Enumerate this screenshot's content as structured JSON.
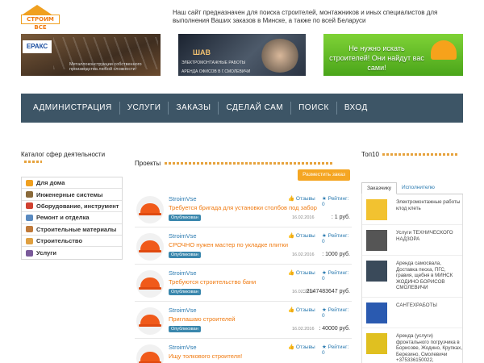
{
  "header": {
    "logo_text": "СТРОИМ ВСЕ",
    "intro": "Наш сайт предназначен для поиска строителей, монтажников и иных специалистов для выполнения Ваших заказов в Минске, а также по всей Беларуси"
  },
  "banners": [
    {
      "brand": "ЕРАКС",
      "caption": "Металлоконструкции собственного производства любой сложности"
    },
    {
      "brand": "ШАВ",
      "subtitle": "ЭЛЕКТРОМОНТАЖНЫЕ РАБОТЫ",
      "caption": "АРЕНДА ОФИСОВ В Г.СМОЛЕВИЧИ"
    },
    {
      "caption": "Не нужно искать строителей! Они найдут вас сами!"
    }
  ],
  "nav": [
    "АДМИНИСТРАЦИЯ",
    "УСЛУГИ",
    "ЗАКАЗЫ",
    "СДЕЛАЙ САМ",
    "ПОИСК",
    "ВХОД"
  ],
  "sidebar": {
    "title": "Каталог сфер деятельности",
    "items": [
      "Для дома",
      "Инженерные системы",
      "Оборудование, инструмент",
      "Ремонт и отделка",
      "Строительные материалы",
      "Строительство",
      "Услуги"
    ],
    "icon_colors": [
      "#f0a020",
      "#8a6a3a",
      "#d04030",
      "#5a8ac0",
      "#c07a3a",
      "#e0a040",
      "#7a5a9a"
    ]
  },
  "projects": {
    "title": "Проекты",
    "post_button": "Разместить заказ",
    "reviews_label": "Отзывы",
    "rating_label": "Рейтинг: 0",
    "status_label": "Опубликован",
    "items": [
      {
        "user": "StroimVse",
        "task": "Требуется бригада для установки столбов под забор",
        "date": "16.02.2016",
        "price": ": 1 руб."
      },
      {
        "user": "StroimVse",
        "task": "СРОЧНО нужен мастер по укладке плитки",
        "date": "16.02.2016",
        "price": ": 1000 руб."
      },
      {
        "user": "StroimVse",
        "task": "Требуются строительство бани",
        "date": "16.02.2016",
        "price": ": 2147483647 руб."
      },
      {
        "user": "StroimVse",
        "task": "Приглашаю строителей",
        "date": "16.02.2016",
        "price": ": 40000 руб."
      },
      {
        "user": "StroimVse",
        "task": "Ищу толкового строителя!",
        "date": "",
        "price": ""
      }
    ]
  },
  "top10": {
    "title": "Топ10",
    "tabs": [
      "Заказчику",
      "Исполнителю"
    ],
    "items": [
      {
        "text": "Электромонтажные работы клод клеть",
        "color": "#f2c230"
      },
      {
        "text": "Услуги ТЕХНИЧЕСКОГО НАДЗОРА",
        "color": "#555555"
      },
      {
        "text": "Аренда самосвала, Доставка песка, ПГС, гравия, щебня в МИНСК ЖОДИНО БОРИСОВ СМОЛЕВИЧИ",
        "color": "#3a4a5a"
      },
      {
        "text": "САНТЕХРАБОТЫ",
        "color": "#2a5ab0"
      },
      {
        "text": "Аренда (услуги) фронтального погрузчика в Борисове, Жодино, Крупках, Березино, Смолевичи +375336150022, +375296046688",
        "color": "#e0c020"
      }
    ]
  }
}
